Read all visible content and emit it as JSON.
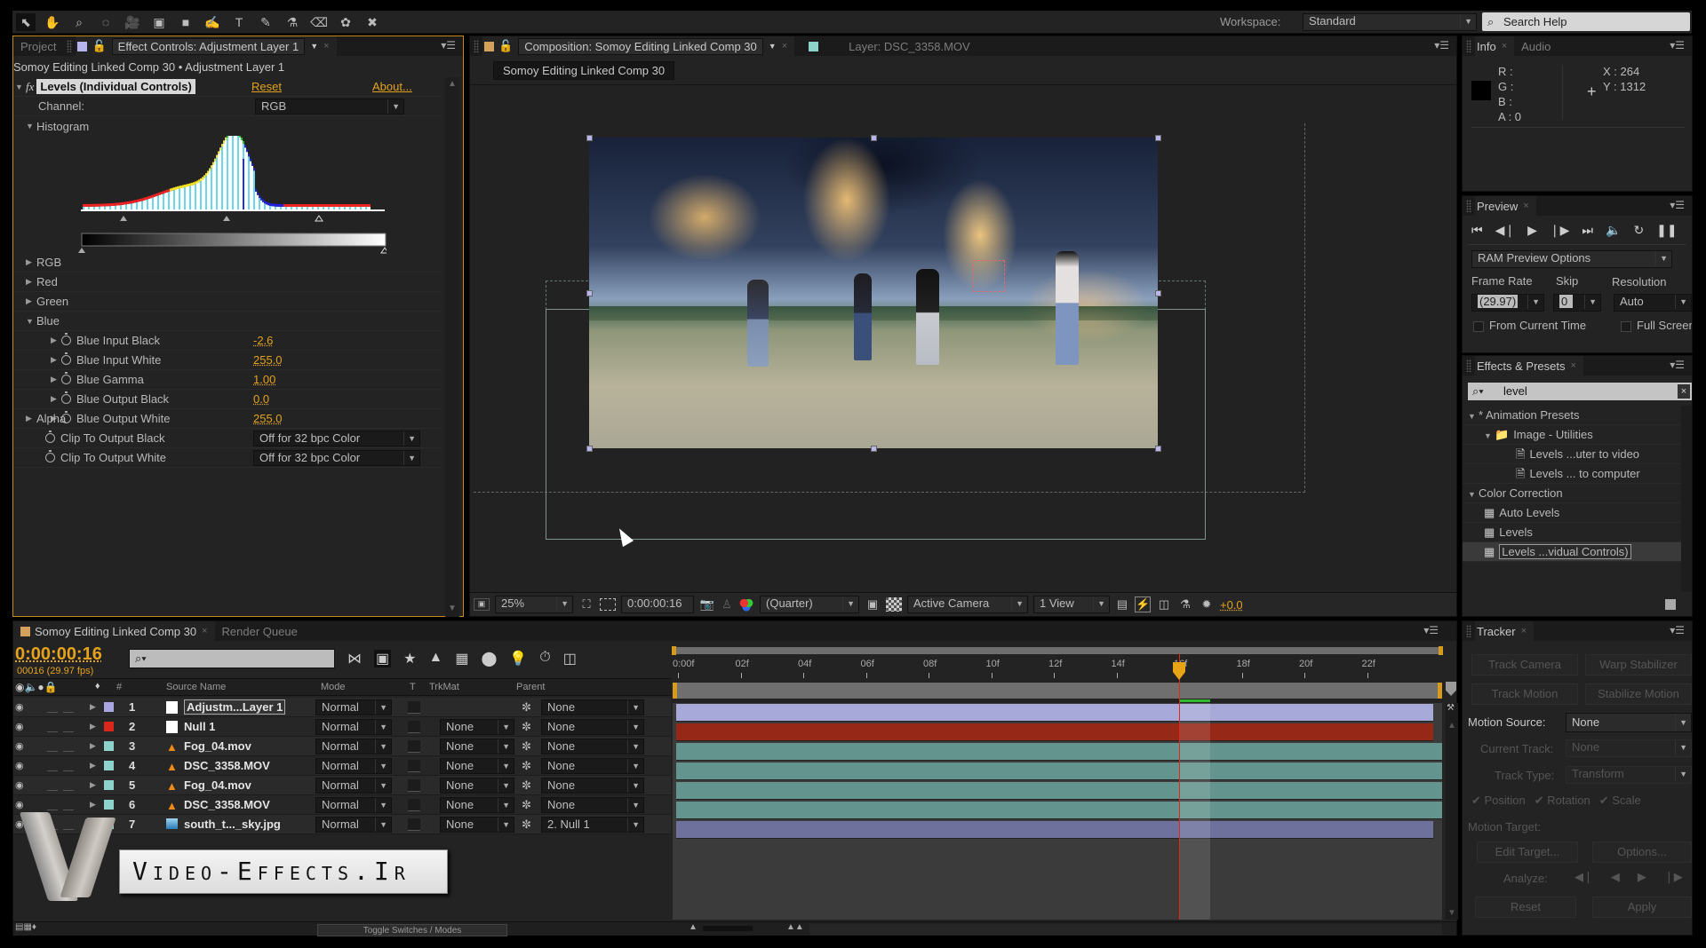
{
  "toolbar": {
    "tools": [
      "selection-tool",
      "hand-tool",
      "zoom-tool",
      "rotate-tool",
      "camera-tool",
      "pan-behind-tool",
      "rectangle-tool",
      "pen-tool",
      "type-tool",
      "brush-tool",
      "clone-stamp-tool",
      "eraser-tool",
      "roto-brush-tool",
      "puppet-tool"
    ],
    "workspace_label": "Workspace:",
    "workspace_value": "Standard",
    "search_placeholder": "Search Help"
  },
  "effect_controls": {
    "tabs": [
      {
        "label": "Project",
        "active": false
      },
      {
        "label": "Effect Controls: Adjustment Layer 1",
        "active": true
      }
    ],
    "breadcrumb": "Somoy Editing Linked Comp 30 • Adjustment Layer 1",
    "effect_name": "Levels (Individual Controls)",
    "reset_label": "Reset",
    "about_label": "About...",
    "channel_label": "Channel:",
    "channel_value": "RGB",
    "histogram_label": "Histogram",
    "groups": [
      {
        "label": "RGB",
        "expanded": false
      },
      {
        "label": "Red",
        "expanded": false
      },
      {
        "label": "Green",
        "expanded": false
      },
      {
        "label": "Blue",
        "expanded": true
      }
    ],
    "blue_params": [
      {
        "label": "Blue Input Black",
        "value": "-2.6"
      },
      {
        "label": "Blue Input White",
        "value": "255.0"
      },
      {
        "label": "Blue Gamma",
        "value": "1.00"
      },
      {
        "label": "Blue Output Black",
        "value": "0.0"
      },
      {
        "label": "Blue Output White",
        "value": "255.0"
      }
    ],
    "alpha_label": "Alpha",
    "clip_params": [
      {
        "label": "Clip To Output Black",
        "value": "Off for 32 bpc Color"
      },
      {
        "label": "Clip To Output White",
        "value": "Off for 32 bpc Color"
      }
    ]
  },
  "composition": {
    "tabs": [
      {
        "label": "Composition: Somoy Editing Linked Comp 30",
        "active": true
      },
      {
        "label": "Layer: DSC_3358.MOV",
        "active": false
      }
    ],
    "comp_name_chip": "Somoy Editing Linked Comp 30",
    "viewer": {
      "zoom": "25%",
      "timecode": "0:00:00:16",
      "resolution": "(Quarter)",
      "camera": "Active Camera",
      "views": "1 View",
      "exposure": "+0.0"
    }
  },
  "info": {
    "tabs": [
      {
        "label": "Info",
        "active": true
      },
      {
        "label": "Audio",
        "active": false
      }
    ],
    "r": "R :",
    "g": "G :",
    "b": "B :",
    "a": "A : 0",
    "x": "X : 264",
    "y": "Y : 1312"
  },
  "preview": {
    "tab": "Preview",
    "options_dropdown": "RAM Preview Options",
    "frame_rate_label": "Frame Rate",
    "frame_rate_value": "(29.97)",
    "skip_label": "Skip",
    "skip_value": "0",
    "resolution_label": "Resolution",
    "resolution_value": "Auto",
    "from_current_time": "From Current Time",
    "full_screen": "Full Screen"
  },
  "effects_presets": {
    "tab": "Effects & Presets",
    "search_value": "level",
    "tree": [
      {
        "label": "* Animation Presets",
        "level": 0,
        "type": "group"
      },
      {
        "label": "Image - Utilities",
        "level": 1,
        "type": "folder"
      },
      {
        "label": "Levels ...uter to video",
        "level": 2,
        "type": "preset"
      },
      {
        "label": "Levels ... to computer",
        "level": 2,
        "type": "preset"
      },
      {
        "label": "Color Correction",
        "level": 0,
        "type": "group"
      },
      {
        "label": "Auto Levels",
        "level": 1,
        "type": "effect"
      },
      {
        "label": "Levels",
        "level": 1,
        "type": "effect"
      },
      {
        "label": "Levels ...vidual Controls)",
        "level": 1,
        "type": "effect",
        "selected": true
      }
    ]
  },
  "timeline": {
    "tabs": [
      {
        "label": "Somoy Editing Linked Comp 30",
        "active": true
      },
      {
        "label": "Render Queue",
        "active": false
      }
    ],
    "timecode": "0:00:00:16",
    "frame_info": "00016 (29.97 fps)",
    "columns": {
      "num": "#",
      "source": "Source Name",
      "mode": "Mode",
      "t": "T",
      "trkmat": "TrkMat",
      "parent": "Parent"
    },
    "ruler_labels": [
      "0:00f",
      "02f",
      "04f",
      "06f",
      "08f",
      "10f",
      "12f",
      "14f",
      "16f",
      "18f",
      "20f",
      "22f"
    ],
    "current_frame": 16,
    "total_frames": 24,
    "layers": [
      {
        "num": "1",
        "name": "Adjustm...Layer 1",
        "label_color": "#a9a6e0",
        "icon": "solid-white",
        "mode": "Normal",
        "trkmat": "",
        "parent": "None",
        "bar_color": "#a7a9d8"
      },
      {
        "num": "2",
        "name": "Null 1",
        "label_color": "#d9271c",
        "icon": "solid-white",
        "mode": "Normal",
        "trkmat": "None",
        "parent": "None",
        "bar_color": "#962818"
      },
      {
        "num": "3",
        "name": "Fog_04.mov",
        "label_color": "#8dd3cc",
        "icon": "vlc-cone",
        "mode": "Normal",
        "trkmat": "None",
        "parent": "None",
        "bar_color": "#63948d"
      },
      {
        "num": "4",
        "name": "DSC_3358.MOV",
        "label_color": "#8dd3cc",
        "icon": "vlc-cone",
        "mode": "Normal",
        "trkmat": "None",
        "parent": "None",
        "bar_color": "#63948d"
      },
      {
        "num": "5",
        "name": "Fog_04.mov",
        "label_color": "#8dd3cc",
        "icon": "vlc-cone",
        "mode": "Normal",
        "trkmat": "None",
        "parent": "None",
        "bar_color": "#63948d"
      },
      {
        "num": "6",
        "name": "DSC_3358.MOV",
        "label_color": "#8dd3cc",
        "icon": "vlc-cone",
        "mode": "Normal",
        "trkmat": "None",
        "parent": "None",
        "bar_color": "#63948d"
      },
      {
        "num": "7",
        "name": "south_t..._sky.jpg",
        "label_color": "#8dd3cc",
        "icon": "image-file",
        "mode": "Normal",
        "trkmat": "None",
        "parent": "2. Null 1",
        "bar_color": "#6d719c"
      }
    ],
    "toggle_label": "Toggle Switches / Modes"
  },
  "tracker": {
    "tab": "Tracker",
    "track_camera": "Track Camera",
    "warp_stabilizer": "Warp Stabilizer",
    "track_motion": "Track Motion",
    "stabilize_motion": "Stabilize Motion",
    "motion_source_label": "Motion Source:",
    "motion_source_value": "None",
    "current_track_label": "Current Track:",
    "current_track_value": "None",
    "track_type_label": "Track Type:",
    "track_type_value": "Transform",
    "position": "Position",
    "rotation": "Rotation",
    "scale": "Scale",
    "motion_target_label": "Motion Target:",
    "edit_target": "Edit Target...",
    "options": "Options...",
    "analyze_label": "Analyze:",
    "reset": "Reset",
    "apply": "Apply"
  },
  "watermark": {
    "text": "Video-Effects.Ir"
  },
  "colors": {
    "accent": "#e5a21c",
    "playhead": "#e0281c",
    "panel_bg": "#232323"
  }
}
